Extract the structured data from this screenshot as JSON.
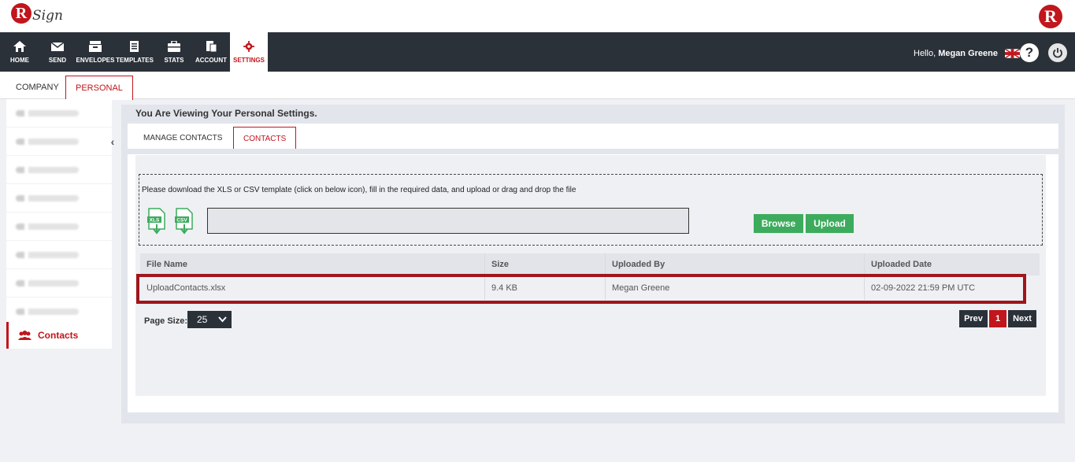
{
  "header": {
    "logo_text": "Sign",
    "logo_letter": "R",
    "brand_letter": "R"
  },
  "nav": {
    "items": [
      {
        "label": "HOME",
        "icon": "home-icon"
      },
      {
        "label": "SEND",
        "icon": "envelope-icon"
      },
      {
        "label": "ENVELOPES",
        "icon": "envelopes-icon"
      },
      {
        "label": "TEMPLATES",
        "icon": "templates-icon"
      },
      {
        "label": "STATS",
        "icon": "stats-icon"
      },
      {
        "label": "ACCOUNT",
        "icon": "account-icon"
      },
      {
        "label": "SETTINGS",
        "icon": "gear-icon",
        "active": true
      }
    ],
    "greeting": "Hello,",
    "user_name": "Megan Greene",
    "help_label": "?"
  },
  "subtabs": {
    "company": "COMPANY",
    "personal": "PERSONAL"
  },
  "sidebar": {
    "active_item": "Contacts",
    "icon": "contacts-icon"
  },
  "main": {
    "title": "You Are Viewing Your Personal Settings.",
    "tabs": {
      "manage_contacts": "MANAGE CONTACTS",
      "contacts": "CONTACTS"
    },
    "instructions": "Please download the XLS or CSV template (click on below icon), fill in the required data, and upload or drag and drop the file",
    "xls_label": "XLS",
    "csv_label": "CSV",
    "browse_label": "Browse",
    "upload_label": "Upload",
    "table": {
      "headers": [
        "File Name",
        "Size",
        "Uploaded By",
        "Uploaded Date"
      ],
      "rows": [
        [
          "UploadContacts.xlsx",
          "9.4 KB",
          "Megan Greene",
          "02-09-2022 21:59 PM UTC"
        ]
      ]
    },
    "page_size_label": "Page Size:",
    "page_size_value": "25",
    "pager": {
      "prev": "Prev",
      "current": "1",
      "next": "Next"
    }
  },
  "colors": {
    "brand_red": "#c0161c",
    "nav_dark": "#2b3139",
    "green": "#3dab5d",
    "highlight": "#a0151b"
  }
}
